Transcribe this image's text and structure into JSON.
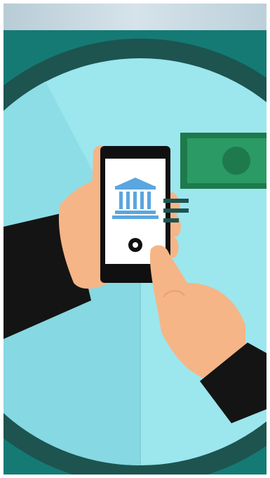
{
  "illustration": {
    "subject": "mobile-banking-payment",
    "icons": [
      "bank-icon",
      "home-button-icon",
      "banknote-icon",
      "speed-lines-icon"
    ]
  },
  "colors": {
    "top_bar": "#c9d9e1",
    "background_teal": "#157a74",
    "ring": "#1d5450",
    "circle_light": "#9ce6ee",
    "circle_mid": "#86d8e2",
    "skin": "#f6b586",
    "sleeve": "#141414",
    "phone_body": "#101010",
    "phone_screen": "#ffffff",
    "bank_blue": "#5aa6e0",
    "banknote": "#2b9a64",
    "banknote_dark": "#1e7a4c"
  }
}
